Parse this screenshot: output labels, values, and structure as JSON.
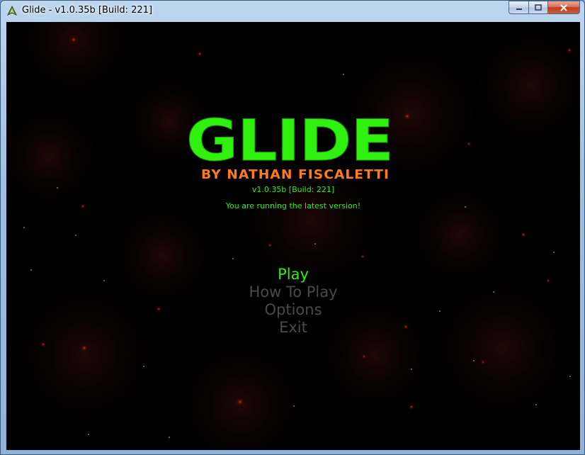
{
  "window": {
    "title": "Glide - v1.0.35b [Build: 221]",
    "icon": "glide-ship-icon",
    "controls": [
      "minimize-icon",
      "maximize-icon",
      "close-icon"
    ]
  },
  "game": {
    "logo": "GLIDE",
    "byline": "BY NATHAN FISCALETTI",
    "version": "v1.0.35b [Build: 221]",
    "status": "You are running the latest version!",
    "menu": {
      "items": [
        "Play",
        "How To Play",
        "Options",
        "Exit"
      ],
      "selected": "Play"
    },
    "colors": {
      "logo_green": "#2ff00f",
      "byline_orange": "#ff7a1a",
      "inactive_menu": "#4a4a4a",
      "background": "#000000",
      "star_glow": "#ff2a1a"
    }
  }
}
